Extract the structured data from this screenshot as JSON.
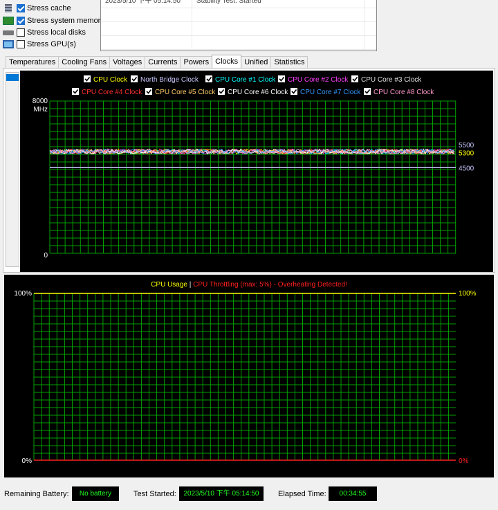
{
  "stress_options": [
    {
      "label": "Stress cache",
      "checked": true,
      "icon": "cache-icon"
    },
    {
      "label": "Stress system memory",
      "checked": true,
      "icon": "memory-icon"
    },
    {
      "label": "Stress local disks",
      "checked": false,
      "icon": "disk-icon"
    },
    {
      "label": "Stress GPU(s)",
      "checked": false,
      "icon": "gpu-icon"
    }
  ],
  "log": {
    "rows": [
      {
        "datetime": "2023/5/10 下午 05:14:50",
        "status": "Stability Test: Started"
      }
    ]
  },
  "tabs": [
    {
      "label": "Temperatures",
      "active": false
    },
    {
      "label": "Cooling Fans",
      "active": false
    },
    {
      "label": "Voltages",
      "active": false
    },
    {
      "label": "Currents",
      "active": false
    },
    {
      "label": "Powers",
      "active": false
    },
    {
      "label": "Clocks",
      "active": true
    },
    {
      "label": "Unified",
      "active": false
    },
    {
      "label": "Statistics",
      "active": false
    }
  ],
  "chart_data": [
    {
      "type": "line",
      "legend": [
        {
          "name": "CPU Clock",
          "color": "#ffff00"
        },
        {
          "name": "North Bridge Clock",
          "color": "#c8c8ff"
        },
        {
          "name": "CPU Core #1 Clock",
          "color": "#00ffff"
        },
        {
          "name": "CPU Core #2 Clock",
          "color": "#ff40ff"
        },
        {
          "name": "CPU Core #3 Clock",
          "color": "#e0e0e0"
        },
        {
          "name": "CPU Core #4 Clock",
          "color": "#ff3030"
        },
        {
          "name": "CPU Core #5 Clock",
          "color": "#ffcc66"
        },
        {
          "name": "CPU Core #6 Clock",
          "color": "#ffffff"
        },
        {
          "name": "CPU Core #7 Clock",
          "color": "#3399ff"
        },
        {
          "name": "CPU Core #8 Clock",
          "color": "#ff99cc"
        }
      ],
      "y_top_label": "8000",
      "y_unit_label": "MHz",
      "y_bottom_label": "0",
      "ylim": [
        0,
        8000
      ],
      "right_labels": [
        {
          "text": "5500",
          "value": 5500,
          "color": "#c8c8ff"
        },
        {
          "text": "5300",
          "value": 5300,
          "color": "#ffff00"
        },
        {
          "text": "4500",
          "value": 4500,
          "color": "#c8c8ff"
        }
      ],
      "series_levels": [
        {
          "name": "CPU Clock",
          "value": 5350
        },
        {
          "name": "North Bridge Clock",
          "value": 4500
        }
      ],
      "grid": true,
      "grid_color": "#00a000"
    },
    {
      "type": "line",
      "legend_usage": "CPU Usage",
      "legend_separator": "|",
      "legend_throttle": "CPU Throttling (max: 5%) - Overheating Detected!",
      "usage_color": "#ffff00",
      "throttle_color": "#ff2020",
      "y_top_label": "100%",
      "y_bottom_label": "0%",
      "right_top_label": "100%",
      "right_bottom_label": "0%",
      "ylim": [
        0,
        100
      ],
      "usage_level": 100,
      "throttle_level": 0,
      "grid": true,
      "grid_color": "#00a000"
    }
  ],
  "status": {
    "battery_label": "Remaining Battery:",
    "battery_value": "No battery",
    "started_label": "Test Started:",
    "started_value": "2023/5/10 下午 05:14:50",
    "elapsed_label": "Elapsed Time:",
    "elapsed_value": "00:34:55"
  }
}
